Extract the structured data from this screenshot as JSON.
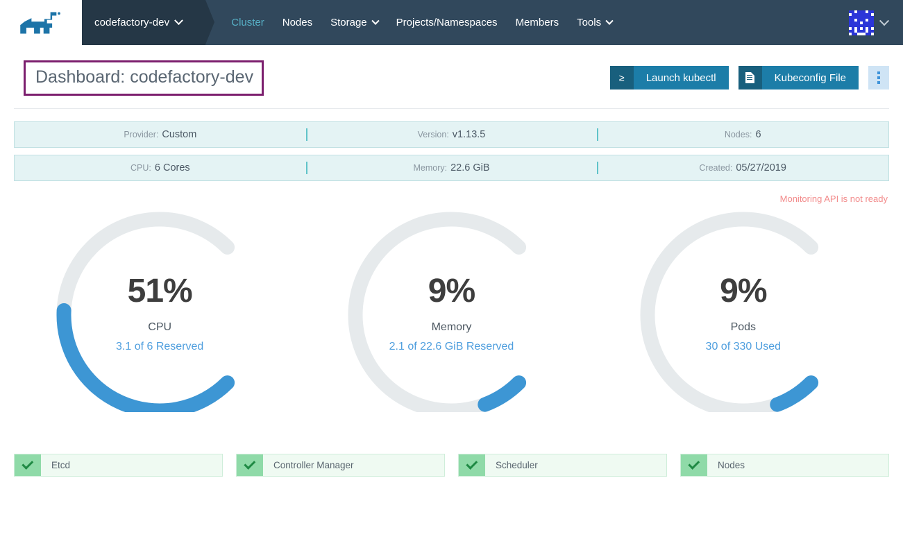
{
  "navbar": {
    "logo_icon": "rancher-cow-logo",
    "cluster_switcher": {
      "name": "codefactory-dev",
      "chevron_icon": "chevron-down-icon"
    },
    "links": [
      {
        "label": "Cluster",
        "active": true
      },
      {
        "label": "Nodes",
        "active": false
      },
      {
        "label": "Storage",
        "active": false,
        "chevron": true
      },
      {
        "label": "Projects/Namespaces",
        "active": false
      },
      {
        "label": "Members",
        "active": false
      },
      {
        "label": "Tools",
        "active": false,
        "chevron": true
      }
    ],
    "avatar_icon": "user-identicon-avatar",
    "avatar_chevron_icon": "chevron-down-icon",
    "colors": {
      "bar": "#31485c",
      "switcher": "#253746",
      "active_link": "#57b0c6"
    }
  },
  "header": {
    "title": "Dashboard: codefactory-dev",
    "title_highlight_color": "#7c1f6e",
    "buttons": [
      {
        "icon": "kubectl-prompt-icon",
        "glyph": "≥",
        "label": "Launch kubectl"
      },
      {
        "icon": "file-icon",
        "glyph": "",
        "label": "Kubeconfig File"
      }
    ],
    "kebab_icon": "kebab-menu-icon"
  },
  "info_rows": [
    [
      {
        "key": "Provider:",
        "value": "Custom"
      },
      {
        "key": "Version:",
        "value": "v1.13.5"
      },
      {
        "key": "Nodes:",
        "value": "6"
      }
    ],
    [
      {
        "key": "CPU:",
        "value": "6 Cores"
      },
      {
        "key": "Memory:",
        "value": "22.6 GiB"
      },
      {
        "key": "Created:",
        "value": "05/27/2019"
      }
    ]
  ],
  "warning": {
    "text": "Monitoring API is not ready",
    "color": "#f28b8b"
  },
  "chart_data": {
    "type": "gauge",
    "title": "Cluster resource utilization gauges",
    "arc_degrees": 270,
    "arc_start_deg": 135,
    "track_color": "#e6eaec",
    "fill_color": "#3d96d4",
    "gauges": [
      {
        "name": "CPU",
        "percent": 51,
        "percent_label": "51%",
        "label": "CPU",
        "sub": "3.1 of 6 Reserved",
        "used": 3.1,
        "total": 6,
        "unit": "Cores",
        "mode": "Reserved"
      },
      {
        "name": "Memory",
        "percent": 9,
        "percent_label": "9%",
        "label": "Memory",
        "sub": "2.1 of 22.6 GiB Reserved",
        "used": 2.1,
        "total": 22.6,
        "unit": "GiB",
        "mode": "Reserved"
      },
      {
        "name": "Pods",
        "percent": 9,
        "percent_label": "9%",
        "label": "Pods",
        "sub": "30 of 330 Used",
        "used": 30,
        "total": 330,
        "unit": "",
        "mode": "Used"
      }
    ]
  },
  "statuses": [
    {
      "label": "Etcd",
      "icon": "check-icon",
      "state": "healthy"
    },
    {
      "label": "Controller Manager",
      "icon": "check-icon",
      "state": "healthy"
    },
    {
      "label": "Scheduler",
      "icon": "check-icon",
      "state": "healthy"
    },
    {
      "label": "Nodes",
      "icon": "check-icon",
      "state": "healthy"
    }
  ]
}
